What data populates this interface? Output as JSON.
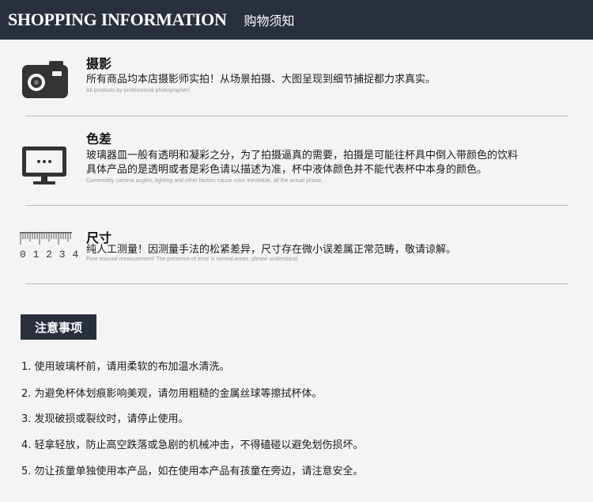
{
  "header": {
    "title_en": "SHOPPING INFORMATION",
    "title_cn": "购物须知"
  },
  "sections": [
    {
      "icon": "camera-icon",
      "title": "摄影",
      "lines": [
        "所有商品均本店摄影师实拍！从场景拍摄、大图呈现到细节捕捉都力求真实。"
      ],
      "note_en": "All products by professional photographer!"
    },
    {
      "icon": "monitor-icon",
      "title": "色差",
      "lines": [
        "玻璃器皿一般有透明和凝彩之分，为了拍摄逼真的需要，拍摄是可能往杯具中倒入带颜色的饮料",
        "具体产品的是透明或者是彩色请以描述为准，杯中液体颜色并不能代表杯中本身的颜色。"
      ],
      "note_en": "Commodity camera angles, lighting and other factors cause color inevitable, all the actual phone."
    },
    {
      "icon": "ruler-icon",
      "ruler_digits": "0 1 2 3 4",
      "title": "尺寸",
      "lines": [
        "纯人工测量！因测量手法的松紧差异，尺寸存在微小误差属正常范畴，敬请谅解。"
      ],
      "note_en": "Pure manual measurement! The presence of error is normal areas, please understand."
    }
  ],
  "notice": {
    "title": "注意事项",
    "items": [
      "1. 使用玻璃杯前，请用柔软的布加温水清洗。",
      "2. 为避免杯体划痕影响美观，请勿用粗糙的金属丝球等擦拭杯体。",
      "3. 发现破损或裂纹时，请停止使用。",
      "4. 轻拿轻放，防止高空跌落或急剧的机械冲击，不得磕碰以避免划伤损坏。",
      "5. 勿让孩童单独使用本产品，如在使用本产品有孩童在旁边，请注意安全。"
    ]
  },
  "colors": {
    "header_bg": "#2a2f3d",
    "page_bg": "#f4f4f4",
    "icon": "#333333"
  }
}
